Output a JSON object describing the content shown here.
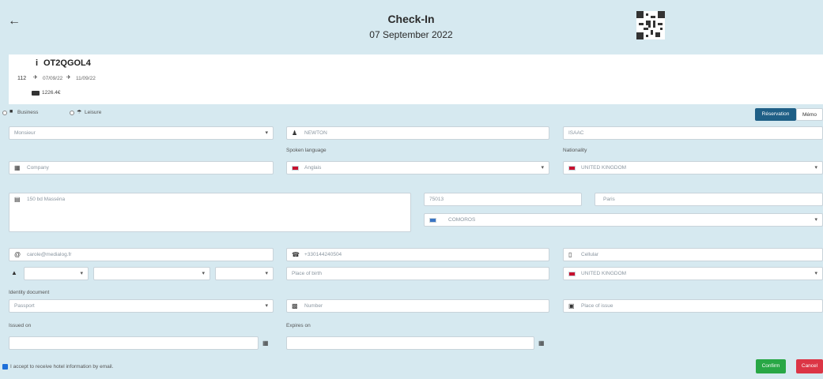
{
  "header": {
    "title": "Check-In",
    "date": "07 September 2022"
  },
  "reservation": {
    "room": "112",
    "code": "OT2QGOL4",
    "arrival": "07/09/22",
    "departure": "11/09/22",
    "amount": "1226.4€"
  },
  "stay_type": {
    "business_label": "Business",
    "leisure_label": "Leisure"
  },
  "tabs": {
    "reservation": "Réservation",
    "memo": "Mémo"
  },
  "form": {
    "civility": "Monsieur",
    "last_name": "NEWTON",
    "first_name": "ISAAC",
    "spoken_language_label": "Spoken language",
    "nationality_label": "Nationality",
    "company_placeholder": "Company",
    "spoken_language": "Anglais",
    "nationality": "UNITED KINGDOM",
    "address": "150 bd Masséna",
    "postcode": "75013",
    "city": "Paris",
    "country": "COMOROS",
    "email": "carole@medialog.fr",
    "phone": "+330144240504",
    "cellular_placeholder": "Cellular",
    "place_of_birth_placeholder": "Place of birth",
    "birth_country": "UNITED KINGDOM",
    "identity_document_label": "Identity document",
    "identity_document": "Passport",
    "number_placeholder": "Number",
    "place_of_issue_placeholder": "Place of issue",
    "issued_on_label": "Issued on",
    "expires_on_label": "Expires on",
    "consent_label": "I accept to receive hotel information by email."
  },
  "buttons": {
    "confirm": "Confirm",
    "cancel": "Cancel"
  },
  "colors": {
    "background": "#d6e9f0",
    "tab_active": "#1f5f86",
    "confirm": "#28a745",
    "cancel": "#dc3545"
  }
}
